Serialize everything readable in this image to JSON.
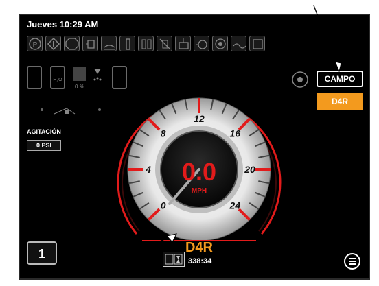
{
  "header": {
    "datetime": "Jueves 10:29 AM"
  },
  "toolbar_icons": [
    "park-brake-icon",
    "warning-icon",
    "stop-icon",
    "spray-valve-icon",
    "tank-level-icon",
    "boom-section-icon",
    "boom-sections-icon",
    "boom-off-icon",
    "tank-fill-icon",
    "pump-icon",
    "hydraulic-icon",
    "agitator-icon",
    "tank-icon"
  ],
  "status_row": {
    "percent": "0 %"
  },
  "agitation": {
    "label": "AGITACIÓN",
    "value": "0 PSI"
  },
  "mode_button": {
    "label": "CAMPO"
  },
  "gear_button": {
    "label": "D4R"
  },
  "speedometer": {
    "value": "0.0",
    "unit": "MPH",
    "ticks": [
      "0",
      "4",
      "8",
      "12",
      "16",
      "20",
      "24"
    ],
    "gear": "D4R",
    "accent": "#e21b1b"
  },
  "gear_number": "1",
  "hours": {
    "value": "338:34"
  },
  "colors": {
    "background": "#000000",
    "accent": "#f39a1e",
    "gauge_red": "#e21b1b"
  }
}
